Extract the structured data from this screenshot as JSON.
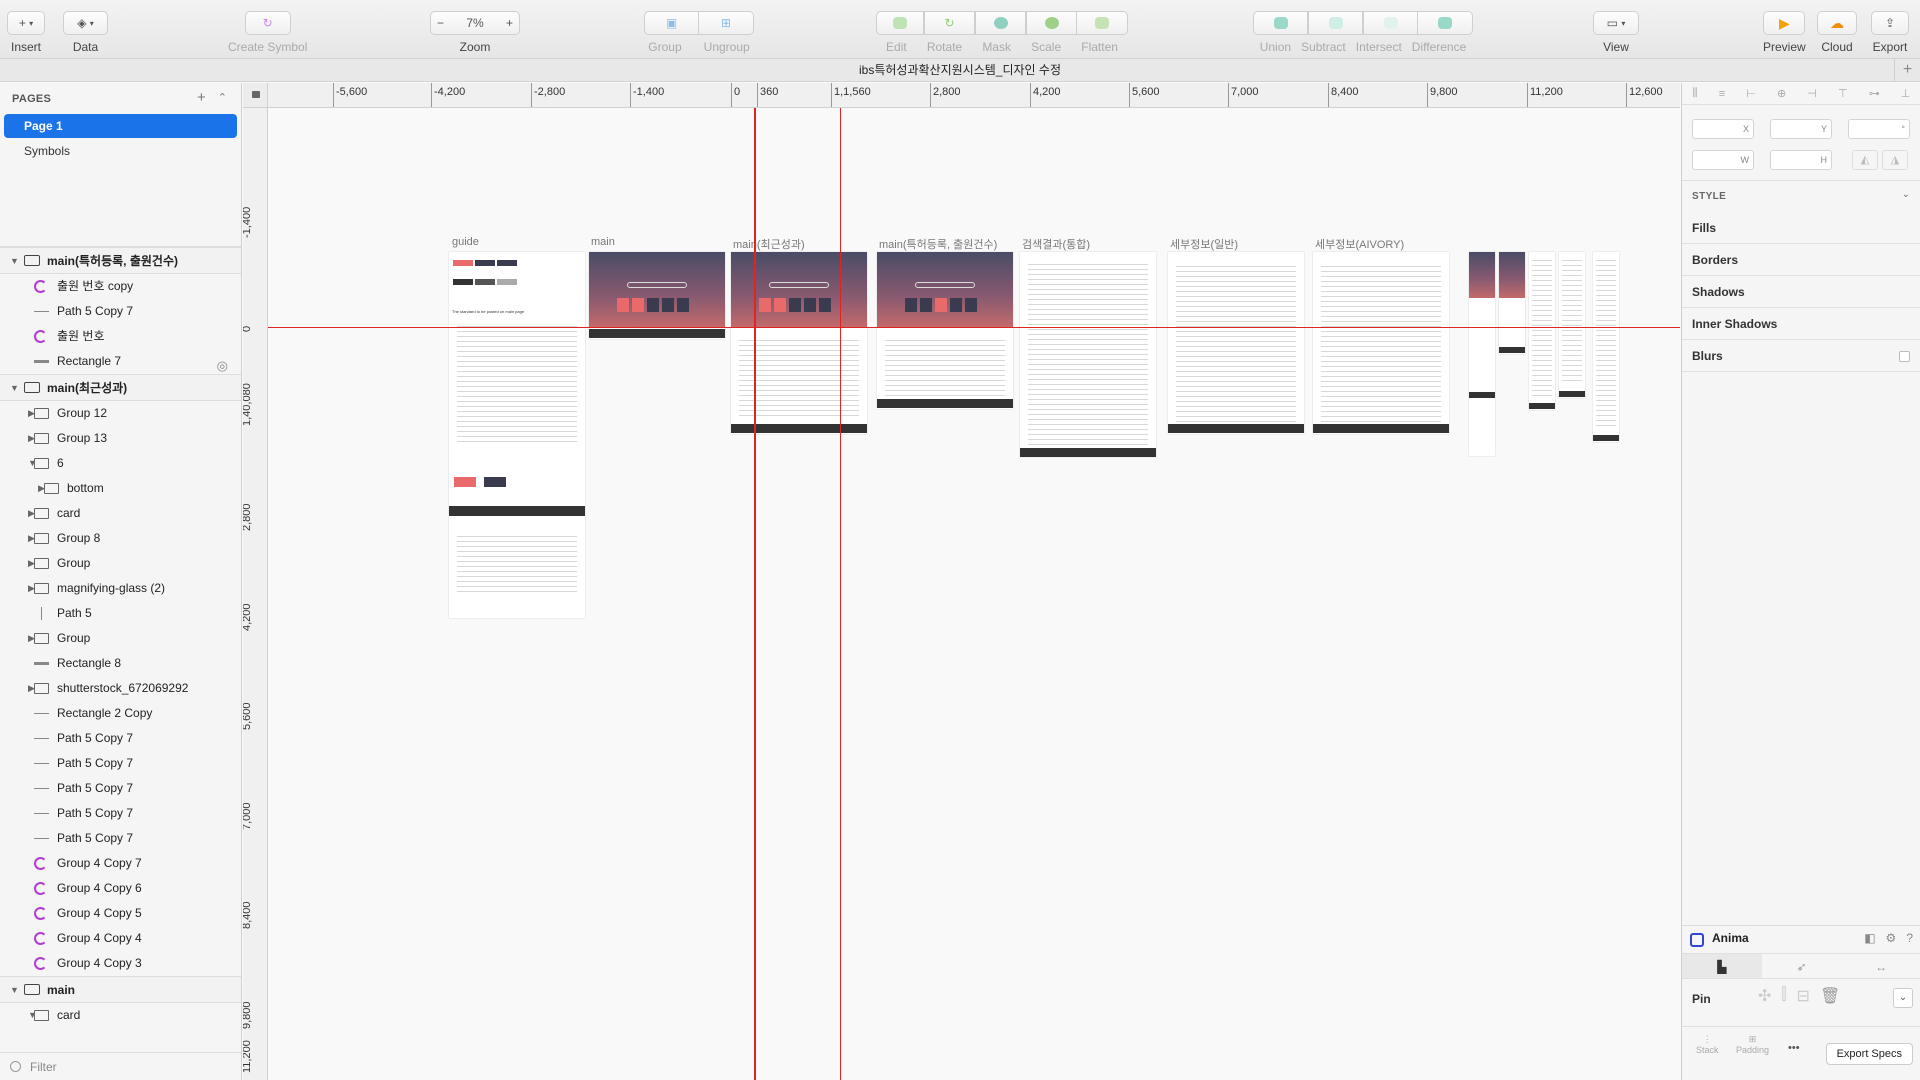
{
  "toolbar": {
    "insert": "Insert",
    "data": "Data",
    "create_symbol": "Create Symbol",
    "zoom": "Zoom",
    "zoom_value": "7%",
    "zoom_minus": "−",
    "zoom_plus": "+",
    "group": "Group",
    "ungroup": "Ungroup",
    "edit": "Edit",
    "rotate": "Rotate",
    "mask": "Mask",
    "scale": "Scale",
    "flatten": "Flatten",
    "union": "Union",
    "subtract": "Subtract",
    "intersect": "Intersect",
    "difference": "Difference",
    "view": "View",
    "preview": "Preview",
    "cloud": "Cloud",
    "export": "Export",
    "insert_symbol": "+"
  },
  "document": {
    "title": "ibs특허성과확산지원시스템_디자인 수정"
  },
  "pages": {
    "header": "PAGES",
    "items": [
      {
        "label": "Page 1",
        "selected": true
      },
      {
        "label": "Symbols",
        "selected": false
      }
    ]
  },
  "layers": [
    {
      "label": "main(특허등록, 출원건수)",
      "type": "artboard",
      "level": 0,
      "arrow": "down"
    },
    {
      "label": "출원 번호 copy",
      "type": "symbol",
      "level": 1
    },
    {
      "label": "Path 5 Copy 7",
      "type": "line",
      "level": 1
    },
    {
      "label": "출원 번호",
      "type": "symbol",
      "level": 1
    },
    {
      "label": "Rectangle 7",
      "type": "rect",
      "level": 1,
      "hidden": true
    },
    {
      "label": "main(최근성과)",
      "type": "artboard",
      "level": 0,
      "arrow": "down"
    },
    {
      "label": "Group 12",
      "type": "folder",
      "level": 1,
      "arrow": "right"
    },
    {
      "label": "Group 13",
      "type": "folder",
      "level": 1,
      "arrow": "right"
    },
    {
      "label": "6",
      "type": "folder",
      "level": 1,
      "arrow": "down"
    },
    {
      "label": "bottom",
      "type": "folder",
      "level": 2,
      "arrow": "right"
    },
    {
      "label": "card",
      "type": "folder",
      "level": 1,
      "arrow": "right"
    },
    {
      "label": "Group 8",
      "type": "folder",
      "level": 1,
      "arrow": "right"
    },
    {
      "label": "Group",
      "type": "folder",
      "level": 1,
      "arrow": "right"
    },
    {
      "label": "magnifying-glass (2)",
      "type": "folder",
      "level": 1,
      "arrow": "right"
    },
    {
      "label": "Path 5",
      "type": "vline",
      "level": 1
    },
    {
      "label": "Group",
      "type": "folder",
      "level": 1,
      "arrow": "right"
    },
    {
      "label": "Rectangle 8",
      "type": "rect",
      "level": 1
    },
    {
      "label": "shutterstock_672069292",
      "type": "folder",
      "level": 1,
      "arrow": "right"
    },
    {
      "label": "Rectangle 2 Copy",
      "type": "line",
      "level": 1
    },
    {
      "label": "Path 5 Copy 7",
      "type": "line",
      "level": 1
    },
    {
      "label": "Path 5 Copy 7",
      "type": "line",
      "level": 1
    },
    {
      "label": "Path 5 Copy 7",
      "type": "line",
      "level": 1
    },
    {
      "label": "Path 5 Copy 7",
      "type": "line",
      "level": 1
    },
    {
      "label": "Path 5 Copy 7",
      "type": "line",
      "level": 1
    },
    {
      "label": "Group 4 Copy 7",
      "type": "symbol",
      "level": 1
    },
    {
      "label": "Group 4 Copy 6",
      "type": "symbol",
      "level": 1
    },
    {
      "label": "Group 4 Copy 5",
      "type": "symbol",
      "level": 1
    },
    {
      "label": "Group 4 Copy 4",
      "type": "symbol",
      "level": 1
    },
    {
      "label": "Group 4 Copy 3",
      "type": "symbol",
      "level": 1
    },
    {
      "label": "main",
      "type": "artboard",
      "level": 0,
      "arrow": "down"
    },
    {
      "label": "card",
      "type": "folder",
      "level": 1,
      "arrow": "down"
    }
  ],
  "filter_placeholder": "Filter",
  "rulers": {
    "horizontal": [
      "-5,600",
      "-4,200",
      "-2,800",
      "-1,400",
      "0",
      "360",
      "1,1,560",
      "2,800",
      "4,200",
      "5,600",
      "7,000",
      "8,400",
      "9,800",
      "11,200",
      "12,600"
    ],
    "vertical": [
      "-1,400",
      "0",
      "1,40,080",
      "2,800",
      "4,200",
      "5,600",
      "7,000",
      "8,400",
      "9,800",
      "11,200"
    ]
  },
  "artboards": [
    {
      "label": "guide"
    },
    {
      "label": "main"
    },
    {
      "label": "main(최근성과)"
    },
    {
      "label": "main(특허등록, 출원건수)"
    },
    {
      "label": "검색결과(통합)"
    },
    {
      "label": "세부정보(일반)"
    },
    {
      "label": "세부정보(AIVORY)"
    }
  ],
  "guide_text": "The standard to be posted on main page",
  "inspector": {
    "x": "X",
    "y": "Y",
    "rot": "°",
    "w": "W",
    "h": "H",
    "style_header": "STYLE",
    "sections": [
      "Fills",
      "Borders",
      "Shadows",
      "Inner Shadows",
      "Blurs"
    ],
    "plugin": "Anima",
    "pin": "Pin",
    "stack": "Stack",
    "padding": "Padding",
    "more": "•••",
    "export_specs": "Export Specs"
  },
  "colors": {
    "accent": "#1a73e8",
    "guide_line": "#e02424",
    "hero_pink": "#e86a6a",
    "symbol": "#b33bd6"
  }
}
